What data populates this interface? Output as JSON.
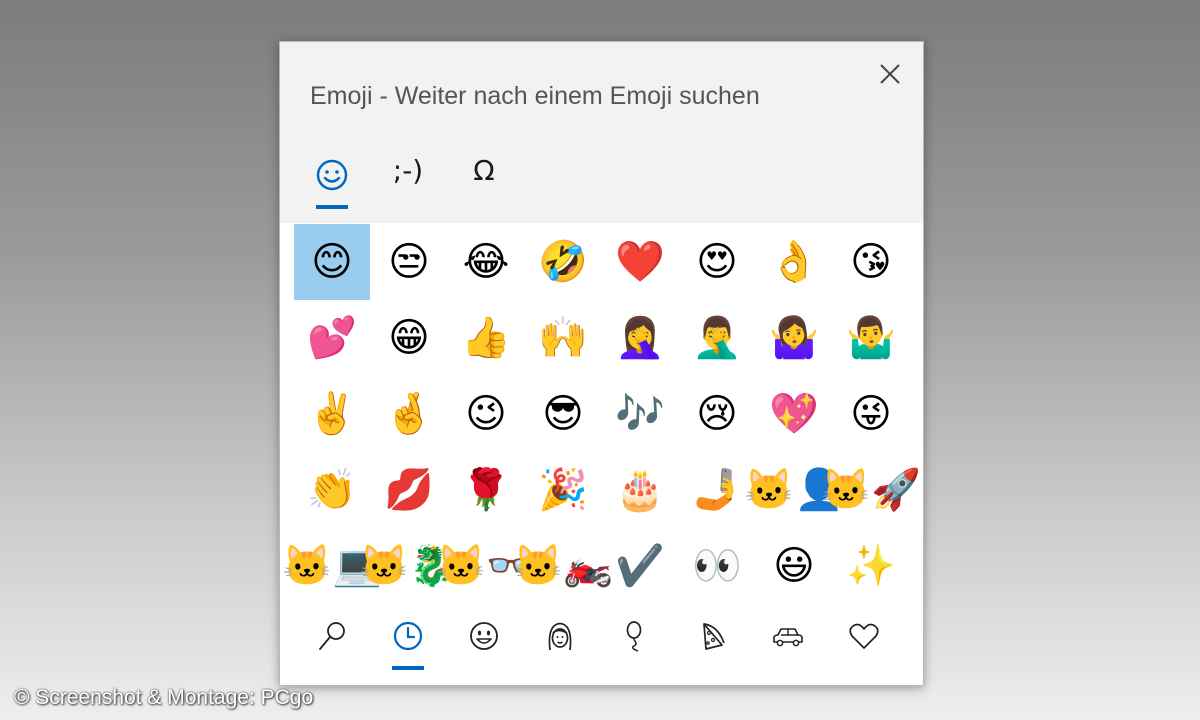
{
  "window": {
    "title": "Emoji - Weiter nach einem Emoji suchen",
    "close_icon": "close-icon"
  },
  "tabs": [
    {
      "name": "emoji",
      "glyph": "",
      "icon": "smiley-icon",
      "active": true
    },
    {
      "name": "kaomoji",
      "glyph": ";-)",
      "icon": "",
      "active": false
    },
    {
      "name": "symbols",
      "glyph": "Ω",
      "icon": "",
      "active": false
    }
  ],
  "emoji_rows": [
    [
      "😊",
      "😒",
      "😂",
      "🤣",
      "❤️",
      "😍",
      "👌",
      "😘"
    ],
    [
      "💕",
      "😁",
      "👍",
      "🙌",
      "🤦‍♀️",
      "🤦‍♂️",
      "🤷‍♀️",
      "🤷‍♂️"
    ],
    [
      "✌️",
      "🤞",
      "😉",
      "😎",
      "🎶",
      "😢",
      "💖",
      "😜"
    ],
    [
      "👏",
      "💋",
      "🌹",
      "🎉",
      "🎂",
      "🤳",
      "🐱‍👤",
      "🐱‍🚀"
    ],
    [
      "🐱‍💻",
      "🐱‍🐉",
      "🐱‍👓",
      "🐱‍🏍",
      "✔️",
      "👀",
      "😃",
      "✨"
    ]
  ],
  "selected_emoji": "😊",
  "categories": [
    {
      "name": "search",
      "icon": "search-icon",
      "active": false
    },
    {
      "name": "recent",
      "icon": "clock-icon",
      "active": true
    },
    {
      "name": "smileys",
      "icon": "smiley-outline-icon",
      "active": false
    },
    {
      "name": "people",
      "icon": "person-icon",
      "active": false
    },
    {
      "name": "celebration",
      "icon": "balloon-icon",
      "active": false
    },
    {
      "name": "food",
      "icon": "pizza-icon",
      "active": false
    },
    {
      "name": "travel",
      "icon": "car-icon",
      "active": false
    },
    {
      "name": "symbols",
      "icon": "heart-icon",
      "active": false
    }
  ],
  "colors": {
    "accent": "#0067c0",
    "selection": "#99ccee",
    "header_bg": "#f2f2f2"
  },
  "credit": "© Screenshot & Montage: PCgo"
}
